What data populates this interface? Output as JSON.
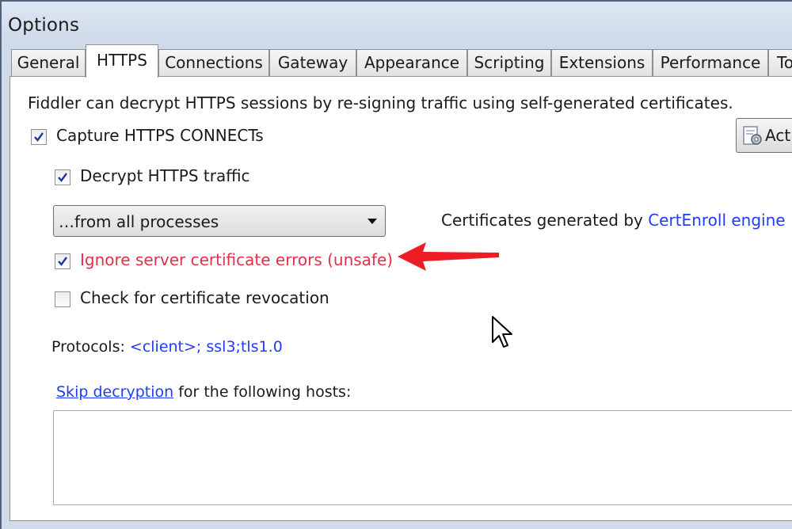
{
  "window": {
    "title": "Options"
  },
  "tabs": [
    {
      "label": "General"
    },
    {
      "label": "HTTPS",
      "active": true
    },
    {
      "label": "Connections"
    },
    {
      "label": "Gateway"
    },
    {
      "label": "Appearance"
    },
    {
      "label": "Scripting"
    },
    {
      "label": "Extensions"
    },
    {
      "label": "Performance"
    },
    {
      "label": "To"
    }
  ],
  "https": {
    "description": "Fiddler can decrypt HTTPS sessions by re-signing traffic using self-generated certificates.",
    "capture_connects": {
      "label": "Capture HTTPS CONNECTs",
      "checked": true
    },
    "actions_button": {
      "label": "Act"
    },
    "decrypt_traffic": {
      "label": "Decrypt HTTPS traffic",
      "checked": true
    },
    "process_filter": {
      "selected": "…from all processes"
    },
    "cert_generator": {
      "prefix": "Certificates generated by ",
      "link": "CertEnroll engine"
    },
    "ignore_errors": {
      "label": "Ignore server certificate errors (unsafe)",
      "checked": true
    },
    "check_revocation": {
      "label": "Check for certificate revocation",
      "checked": false
    },
    "protocols": {
      "label": "Protocols: ",
      "value": "<client>; ssl3;tls1.0"
    },
    "skip_decryption": {
      "link": "Skip decryption",
      "suffix": " for the following hosts:"
    },
    "hosts_value": ""
  },
  "colors": {
    "link": "#1f3bff",
    "warning_text": "#e0304a",
    "annotation_arrow": "#ee1c24",
    "window_frame": "#cfdbea"
  },
  "icons": {
    "checkbox_check": "check-icon",
    "dropdown": "chevron-down-icon",
    "actions": "certificate-gear-icon",
    "annotation": "red-arrow-icon",
    "pointer": "mouse-cursor-icon"
  }
}
